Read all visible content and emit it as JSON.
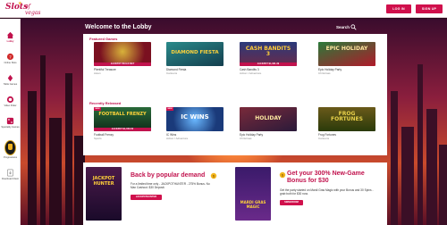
{
  "brand": {
    "name": "Slots",
    "suffix": "of vegas"
  },
  "header": {
    "login": "LOG IN",
    "signup": "SIGN UP"
  },
  "sidebar": {
    "items": [
      {
        "label": "Lobby",
        "icon": "home-icon",
        "active": true
      },
      {
        "label": "Online Slots",
        "icon": "slot-machine-icon",
        "active": false
      },
      {
        "label": "Table Games",
        "icon": "cards-icon",
        "active": false
      },
      {
        "label": "Video Poker",
        "icon": "poker-chip-icon",
        "active": false
      },
      {
        "label": "Speciality Games",
        "icon": "dice-icon",
        "active": false
      },
      {
        "label": "Progressives",
        "icon": "trophy-badge-icon",
        "active": false
      },
      {
        "label": "Download Client",
        "icon": "download-icon",
        "active": false
      }
    ]
  },
  "lobby": {
    "title": "Welcome to the Lobby",
    "search_label": "Search"
  },
  "featured": {
    "title": "Featured Games",
    "games": [
      {
        "name": "Plentiful Treasure",
        "category": "Asian",
        "strip": "JACKPOT BUILD BET",
        "art": "",
        "color": "#7a1020"
      },
      {
        "name": "Diamond Fiesta",
        "category": "Cartoons",
        "strip": "",
        "art": "DIAMOND FIESTA",
        "color": "#1a6a6a"
      },
      {
        "name": "Cash Bandits 3",
        "category": "Action / Adventure",
        "strip": "JACKPOT $1,081.39",
        "art": "CASH BANDITS 3",
        "color": "#2a3a6a"
      },
      {
        "name": "Epic Holiday Party",
        "category": "Christmas",
        "strip": "",
        "art": "EPIC HOLIDAY",
        "color": "#1c5a2a"
      }
    ]
  },
  "recent": {
    "title": "Recently Released",
    "games": [
      {
        "name": "Football Frenzy",
        "category": "Sports",
        "strip": "JACKPOT $1,053.50",
        "art": "FOOTBALL FRENZY",
        "color": "#1a4a2a",
        "new": true
      },
      {
        "name": "IC Wins",
        "category": "Action / Adventure",
        "strip": "",
        "art": "IC WINS",
        "color": "#1a3a7a",
        "new": true
      },
      {
        "name": "Epic Holiday Party",
        "category": "Christmas",
        "strip": "",
        "art": "HOLIDAY",
        "color": "#5a1a2a",
        "new": false
      },
      {
        "name": "Frog Fortunes",
        "category": "Cartoons",
        "strip": "",
        "art": "FROG FORTUNES",
        "color": "#4a3a0a",
        "new": false
      }
    ]
  },
  "new_tag": "NEW",
  "promos": [
    {
      "title": "Back by popular demand",
      "text": "For a limited time only - JACKPOTHUNTER - 275% Bonus. No Max Cashout. $30 Deposit.",
      "button": "JACKPOTHUNTER",
      "art": "JACKPOT HUNTER"
    },
    {
      "title": "Get your 300% New-Game Bonus for $30",
      "text": "Get the party started on Mardi Gras Magic with your Bonus and 30 Spins - grab both for $30 now.",
      "button": "SWEEDOOM",
      "art": "MARDI GRAS MAGIC"
    }
  ],
  "colors": {
    "accent": "#c1124d",
    "button": "#d0104c",
    "bg": "#2a0a1c"
  }
}
